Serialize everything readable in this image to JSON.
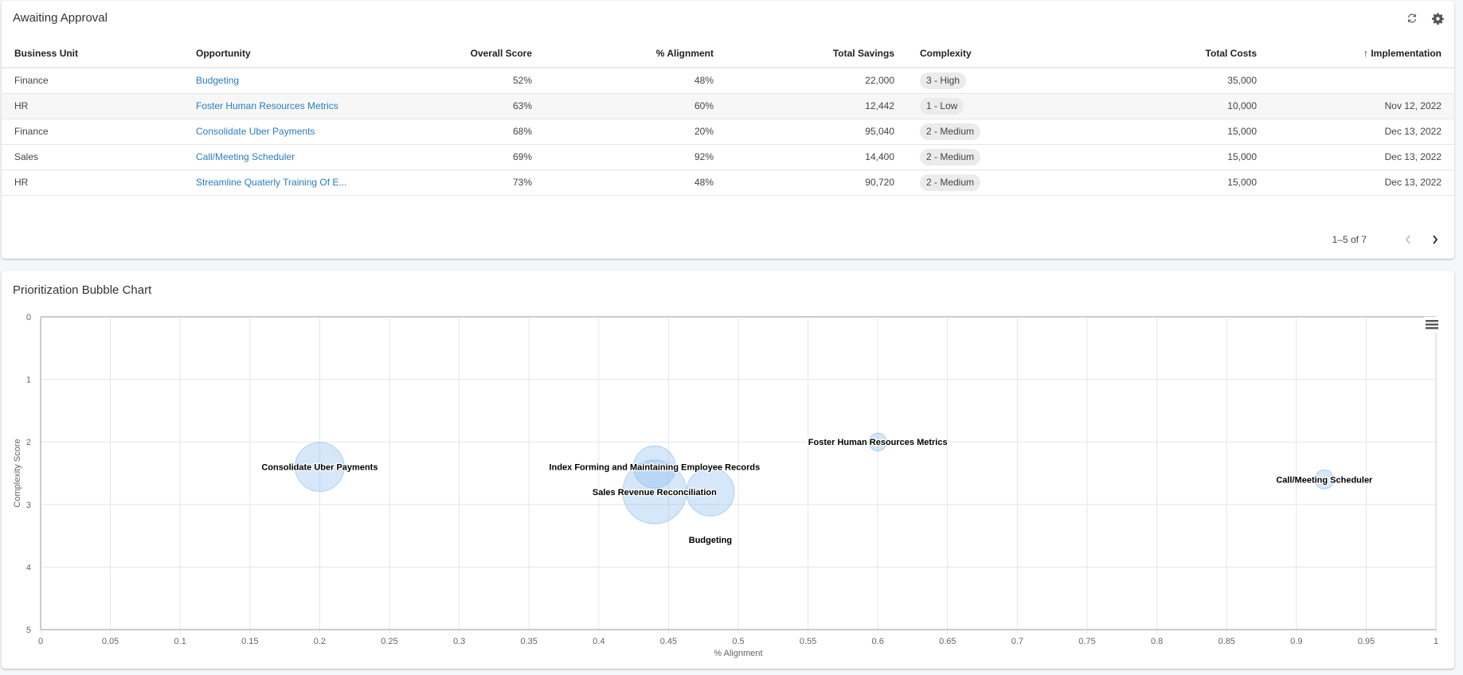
{
  "approval": {
    "title": "Awaiting Approval",
    "icons": [
      "refresh-icon",
      "gear-icon"
    ],
    "columns": [
      {
        "label": "Business Unit",
        "align": "l"
      },
      {
        "label": "Opportunity",
        "align": "l"
      },
      {
        "label": "Overall Score",
        "align": "r"
      },
      {
        "label": "% Alignment",
        "align": "r"
      },
      {
        "label": "Total Savings",
        "align": "r"
      },
      {
        "label": "Complexity",
        "align": "l"
      },
      {
        "label": "Total Costs",
        "align": "r"
      },
      {
        "label": "Implementation",
        "align": "r",
        "sort_icon": "↑"
      }
    ],
    "rows": [
      {
        "unit": "Finance",
        "opportunity": "Budgeting",
        "score": "52%",
        "alignment": "48%",
        "savings": "22,000",
        "complexity": "3 - High",
        "costs": "35,000",
        "implementation": ""
      },
      {
        "unit": "HR",
        "opportunity": "Foster Human Resources Metrics",
        "score": "63%",
        "alignment": "60%",
        "savings": "12,442",
        "complexity": "1 - Low",
        "costs": "10,000",
        "implementation": "Nov 12, 2022"
      },
      {
        "unit": "Finance",
        "opportunity": "Consolidate Uber Payments",
        "score": "68%",
        "alignment": "20%",
        "savings": "95,040",
        "complexity": "2 - Medium",
        "costs": "15,000",
        "implementation": "Dec 13, 2022"
      },
      {
        "unit": "Sales",
        "opportunity": "Call/Meeting Scheduler",
        "score": "69%",
        "alignment": "92%",
        "savings": "14,400",
        "complexity": "2 - Medium",
        "costs": "15,000",
        "implementation": "Dec 13, 2022"
      },
      {
        "unit": "HR",
        "opportunity": "Streamline Quaterly Training Of E...",
        "score": "73%",
        "alignment": "48%",
        "savings": "90,720",
        "complexity": "2 - Medium",
        "costs": "15,000",
        "implementation": "Dec 13, 2022"
      }
    ],
    "pagination": {
      "text": "1–5 of 7",
      "prev_icon": "‹",
      "next_icon": "›"
    }
  },
  "chart_card": {
    "title": "Prioritization Bubble Chart",
    "menu_icon": "hamburger-menu-icon"
  },
  "chart_data": {
    "type": "scatter",
    "subtype": "bubble",
    "title": "Prioritization Bubble Chart",
    "xlabel": "% Alignment",
    "ylabel": "Complexity Score",
    "xlim": [
      0,
      1
    ],
    "ylim": [
      0,
      5
    ],
    "y_reversed": true,
    "grid": true,
    "x_ticks": [
      "0",
      "0.05",
      "0.1",
      "0.15",
      "0.2",
      "0.25",
      "0.3",
      "0.35",
      "0.4",
      "0.45",
      "0.5",
      "0.55",
      "0.6",
      "0.65",
      "0.7",
      "0.75",
      "0.8",
      "0.85",
      "0.9",
      "0.95",
      "1"
    ],
    "y_ticks": [
      "0",
      "1",
      "2",
      "3",
      "4",
      "5"
    ],
    "bubble_color": "#7cb5ec",
    "points": [
      {
        "name": "Consolidate Uber Payments",
        "x": 0.2,
        "y": 2.4,
        "z": 95040,
        "label": "Consolidate Uber Payments"
      },
      {
        "name": "Index Forming and Maintaining Employee Records",
        "x": 0.44,
        "y": 2.4,
        "z": 70000,
        "label": "Index Forming and Maintaining Employee Records"
      },
      {
        "name": "Sales Revenue Reconciliation",
        "x": 0.44,
        "y": 2.8,
        "z": 160000,
        "label": "Sales Revenue Reconciliation"
      },
      {
        "name": "Streamline Quaterly Training Of E...",
        "x": 0.48,
        "y": 2.8,
        "z": 90720,
        "label": ""
      },
      {
        "name": "Budgeting",
        "x": 0.48,
        "y": 3.56,
        "z": 1000,
        "label": "Budgeting"
      },
      {
        "name": "Foster Human Resources Metrics",
        "x": 0.6,
        "y": 2.0,
        "z": 12442,
        "label": "Foster Human Resources Metrics"
      },
      {
        "name": "Call/Meeting Scheduler",
        "x": 0.92,
        "y": 2.6,
        "z": 14400,
        "label": "Call/Meeting Scheduler"
      }
    ]
  }
}
